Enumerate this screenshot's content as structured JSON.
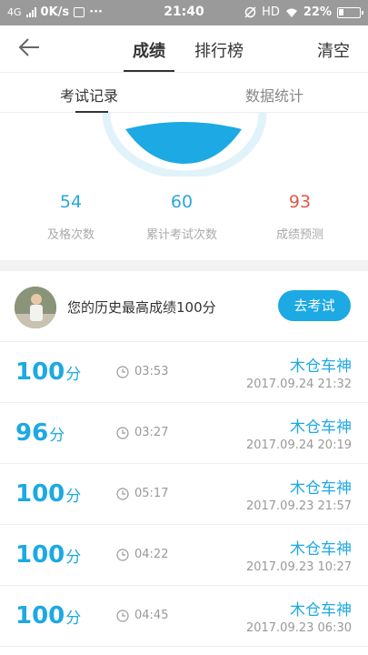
{
  "status_bar": {
    "network": "4G",
    "speed": "0K/s",
    "more": "···",
    "time": "21:40",
    "hd": "HD",
    "battery": "22%"
  },
  "nav": {
    "back_icon": "back-arrow-icon",
    "tabs": [
      {
        "label": "成绩",
        "active": true
      },
      {
        "label": "排行榜",
        "active": false
      }
    ],
    "clear_label": "清空"
  },
  "sub_tabs": [
    {
      "label": "考试记录",
      "active": true
    },
    {
      "label": "数据统计",
      "active": false
    }
  ],
  "gauge": {
    "color": "#1da9e3",
    "ring_color": "#e1f3fa"
  },
  "stats": {
    "pass_count": {
      "value": "54",
      "label": "及格次数",
      "color": "#2aa7dc"
    },
    "total_count": {
      "value": "60",
      "label": "累计考试次数",
      "color": "#2aa7dc"
    },
    "prediction": {
      "value": "93",
      "label": "成绩预测",
      "color": "#e0584b"
    }
  },
  "best": {
    "text": "您的历史最高成绩100分",
    "button_label": "去考试"
  },
  "records": [
    {
      "score": "100",
      "unit": "分",
      "duration": "03:53",
      "name": "木仓车神",
      "date": "2017.09.24  21:32"
    },
    {
      "score": "96",
      "unit": "分",
      "duration": "03:27",
      "name": "木仓车神",
      "date": "2017.09.24  20:19"
    },
    {
      "score": "100",
      "unit": "分",
      "duration": "05:17",
      "name": "木仓车神",
      "date": "2017.09.23  21:57"
    },
    {
      "score": "100",
      "unit": "分",
      "duration": "04:22",
      "name": "木仓车神",
      "date": "2017.09.23  10:27"
    },
    {
      "score": "100",
      "unit": "分",
      "duration": "04:45",
      "name": "木仓车神",
      "date": "2017.09.23  06:30"
    }
  ]
}
